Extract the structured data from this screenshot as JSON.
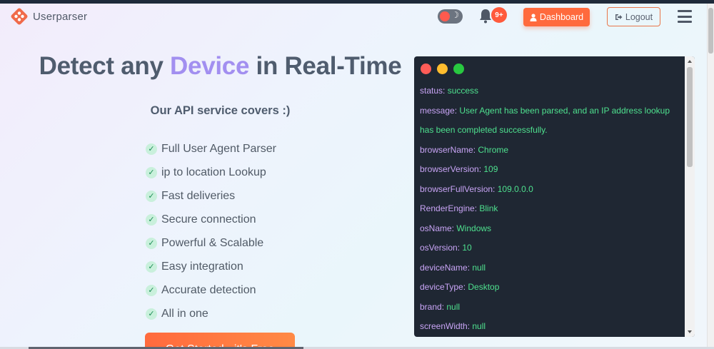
{
  "brand": {
    "name": "Userparser",
    "logo_icon": "diamond-logo-icon",
    "brand_color": "#f06a4a"
  },
  "nav": {
    "theme_toggle_icon": "moon-icon",
    "notification_icon": "bell-icon",
    "notification_badge": "9+",
    "dashboard_label": "Dashboard",
    "dashboard_icon": "user-icon",
    "logout_label": "Logout",
    "logout_icon": "sign-out-icon",
    "menu_icon": "hamburger-icon"
  },
  "hero": {
    "title_part1": "Detect any ",
    "title_accent": "Device",
    "title_part2": " in Real-Time",
    "subtitle": "Our API service covers :)",
    "features": [
      "Full User Agent Parser",
      "ip to location Lookup",
      "Fast deliveries",
      "Secure connection",
      "Powerful & Scalable",
      "Easy integration",
      "Accurate detection",
      "All in one"
    ],
    "cta_label": "Get Started - it's Free"
  },
  "terminal": {
    "lines": [
      {
        "key": "status: ",
        "value": "success"
      },
      {
        "key": "message: ",
        "value": "User Agent has been parsed, and an IP address lookup"
      },
      {
        "key": "",
        "value": "has been completed successfully."
      },
      {
        "key": "browserName: ",
        "value": "Chrome"
      },
      {
        "key": "browserVersion: ",
        "value": "109"
      },
      {
        "key": "browserFullVersion: ",
        "value": "109.0.0.0"
      },
      {
        "key": "RenderEngine: ",
        "value": "Blink"
      },
      {
        "key": "osName: ",
        "value": "Windows"
      },
      {
        "key": "osVersion: ",
        "value": "10"
      },
      {
        "key": "deviceName: ",
        "value": "null"
      },
      {
        "key": "deviceType: ",
        "value": "Desktop"
      },
      {
        "key": "brand: ",
        "value": "null"
      },
      {
        "key": "screenWidth: ",
        "value": "null"
      }
    ]
  },
  "colors": {
    "accent_orange": "#ff6a3d",
    "headline_accent": "#a28ff0",
    "terminal_bg": "#1f2733",
    "terminal_key": "#c8a4f5",
    "terminal_value": "#4ee08e"
  }
}
